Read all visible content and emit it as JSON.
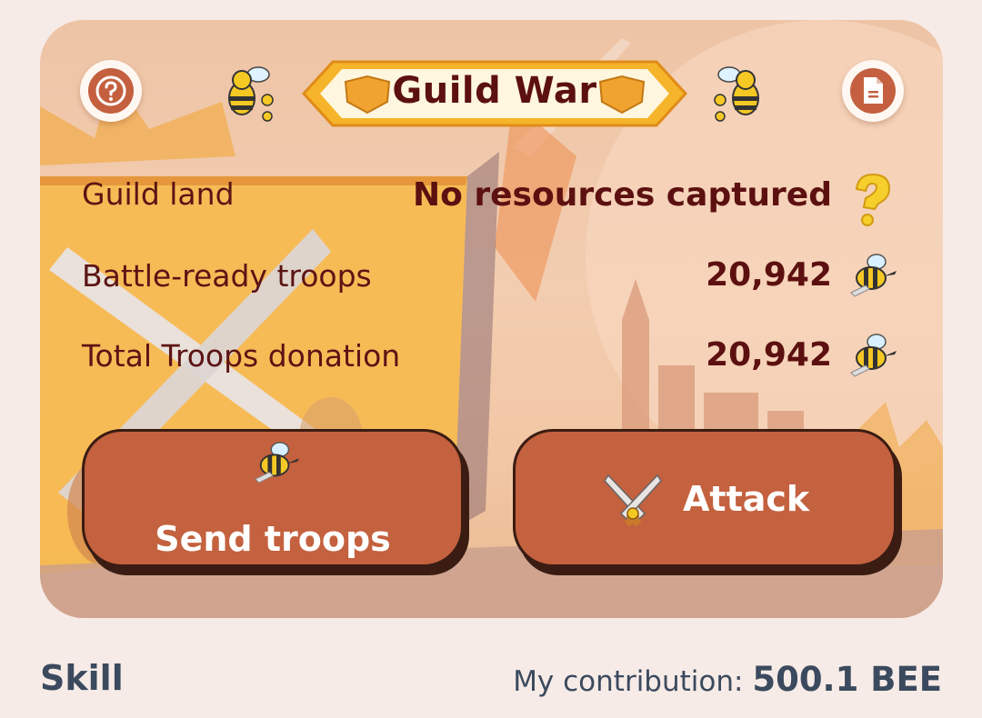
{
  "header": {
    "title": "Guild War",
    "help_icon": "question-mark-icon",
    "rules_icon": "document-icon"
  },
  "stats": {
    "guild_land": {
      "label": "Guild land",
      "value": "No resources captured",
      "icon": "question-mark-icon"
    },
    "battle_ready": {
      "label": "Battle-ready troops",
      "value": "20,942",
      "icon": "bee-soldier-icon"
    },
    "total_donation": {
      "label": "Total Troops donation",
      "value": "20,942",
      "icon": "bee-soldier-icon"
    }
  },
  "actions": {
    "send_troops": {
      "label": "Send troops",
      "icon": "bee-soldier-icon"
    },
    "attack": {
      "label": "Attack",
      "icon": "crossed-swords-icon"
    }
  },
  "footer": {
    "section_title": "Skill",
    "contribution_label": "My contribution:",
    "contribution_value": "500.1 BEE"
  },
  "colors": {
    "background": "#f7ebe7",
    "button": "#c4613f",
    "button_shadow": "#3a1c12",
    "text_dark_red": "#5c1010",
    "footer_text": "#3b4a5e",
    "banner_gold": "#f5b429"
  }
}
